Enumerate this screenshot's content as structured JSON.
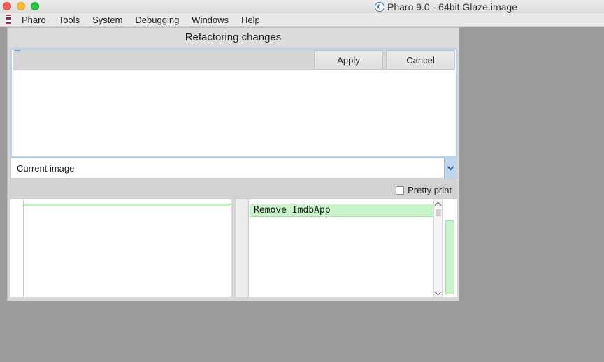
{
  "os": {
    "window_title": "Pharo 9.0 - 64bit Glaze.image"
  },
  "menubar": {
    "items": [
      "Pharo",
      "Tools",
      "System",
      "Debugging",
      "Windows",
      "Help"
    ]
  },
  "dialog": {
    "title": "Refactoring changes",
    "apply_label": "Apply",
    "cancel_label": "Cancel",
    "target_selected": "Current image",
    "pretty_print_label": "Pretty print",
    "pretty_print_checked": false,
    "diff_right_line": "Remove ImdbApp"
  },
  "colors": {
    "added": "#c9f3c9",
    "selection": "#bfd6f1"
  }
}
